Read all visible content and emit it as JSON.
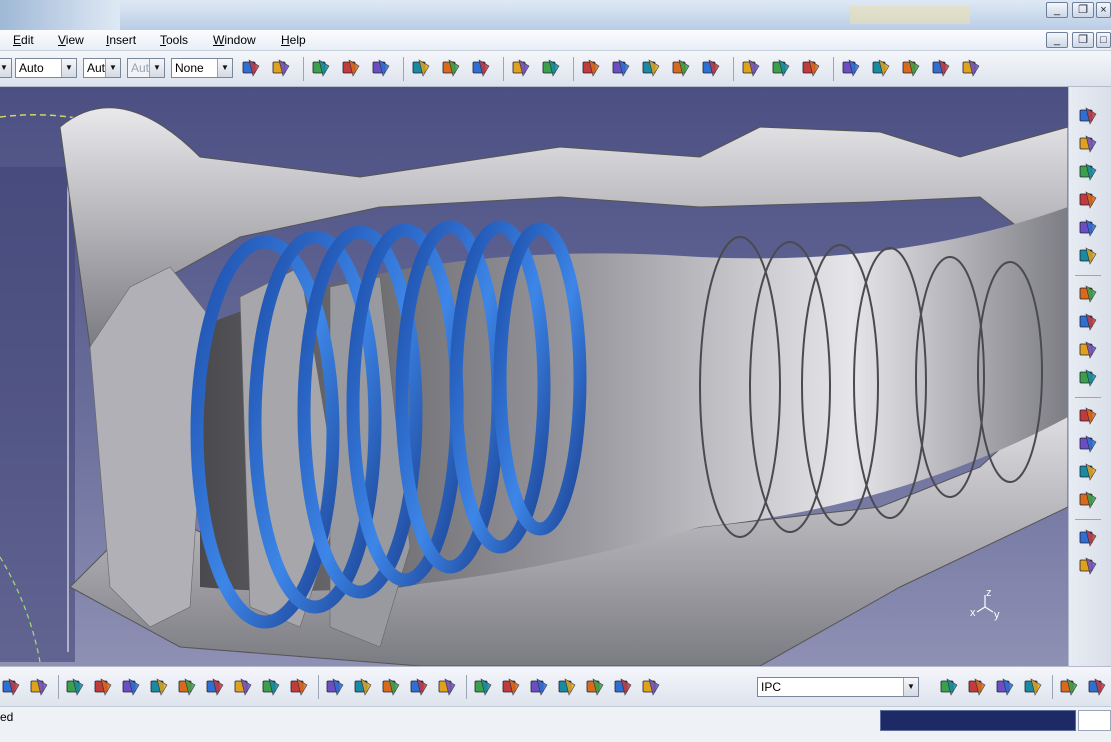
{
  "menu": {
    "items": [
      "Edit",
      "View",
      "Insert",
      "Tools",
      "Window",
      "Help"
    ]
  },
  "toolbar_top": {
    "combo_color": "",
    "combo_linetype": "Auto",
    "combo_thickness": "Aut",
    "combo_point": "Aut",
    "combo_layer": "None"
  },
  "toolbar_bottom": {
    "current_layer": "IPC"
  },
  "compass": {
    "z": "z",
    "x": "x",
    "y": "y"
  },
  "status": {
    "text": "ed"
  },
  "colors": {
    "viewport_top": "#4b4f82",
    "viewport_bottom": "#8e90b4",
    "ring_blue": "#2a63c4",
    "metal_gray": "#a9a9ad"
  },
  "icons_top": [
    "sketch-icon",
    "point-icon",
    "spline-icon",
    "curve-icon",
    "surface-icon",
    "measure-icon",
    "analysis-icon",
    "rotate-part-icon",
    "grid-icon",
    "compass-tool-icon",
    "catalog-icon",
    "parts-icon",
    "assembly-icon",
    "product-icon",
    "gear-icon",
    "render-icon",
    "material-icon",
    "knowledge-icon",
    "fit-icon",
    "snap-icon",
    "manipulate-icon",
    "constraint-icon",
    "workbench-icon"
  ],
  "icons_right": [
    "pad-icon",
    "pocket-icon",
    "shaft-icon",
    "groove-icon",
    "hole-icon",
    "rib-icon",
    "fillet-icon",
    "chamfer-icon",
    "draft-icon",
    "shell-icon",
    "pattern-icon",
    "boolean-icon",
    "thickness-icon",
    "split-icon",
    "apply-material-icon",
    "eraser-icon"
  ],
  "icons_bottom": [
    "fly-mode-icon",
    "fit-all-icon",
    "pan-icon",
    "rotate-icon",
    "zoom-in-icon",
    "zoom-out-icon",
    "normal-view-icon",
    "quick-view-icon",
    "shading-icon",
    "hide-show-icon",
    "swap-space-icon",
    "refresh-icon",
    "hand-icon",
    "axis-icon",
    "tree-icon",
    "grid-view-icon",
    "cube-icon",
    "box-icon",
    "section-icon",
    "paint-icon",
    "spec-tree-icon",
    "light-icon",
    "layers-icon",
    "layer-filter-icon",
    "properties-icon",
    "mass-icon",
    "capture-icon",
    "camera-icon",
    "render-style-icon"
  ]
}
